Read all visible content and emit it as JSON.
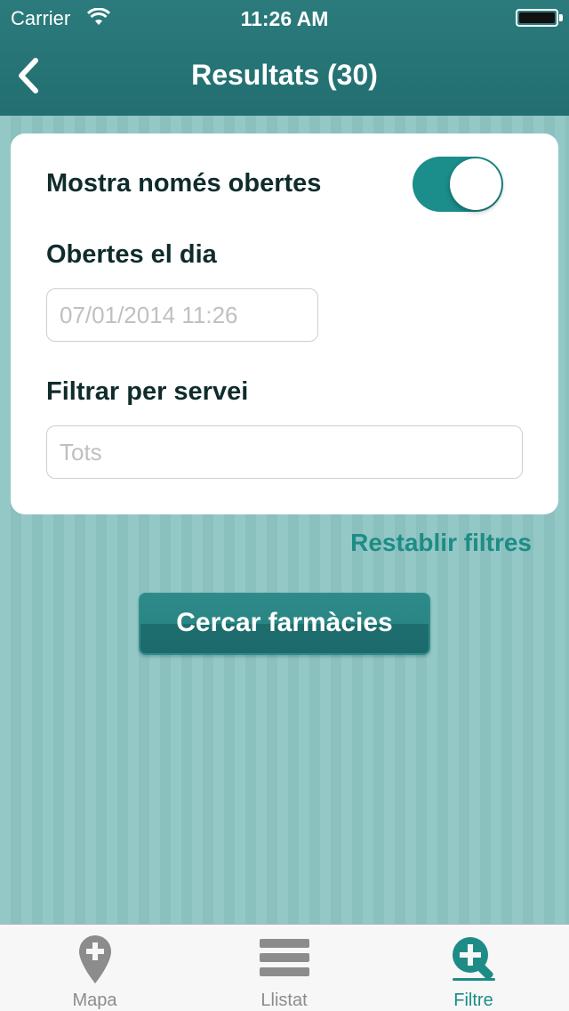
{
  "status_bar": {
    "carrier": "Carrier",
    "time": "11:26 AM"
  },
  "nav": {
    "title": "Resultats (30)",
    "back_icon": "chevron-left-icon"
  },
  "filters": {
    "open_only_label": "Mostra només obertes",
    "open_only_enabled": true,
    "open_on_day_label": "Obertes el dia",
    "date_placeholder": "07/01/2014 11:26",
    "service_label": "Filtrar per servei",
    "service_placeholder": "Tots"
  },
  "actions": {
    "reset_label": "Restablir filtres",
    "search_label": "Cercar farmàcies"
  },
  "tabs": [
    {
      "label": "Mapa",
      "icon": "map-pin-icon",
      "active": false
    },
    {
      "label": "Llistat",
      "icon": "list-icon",
      "active": false
    },
    {
      "label": "Filtre",
      "icon": "filter-search-icon",
      "active": true
    }
  ],
  "colors": {
    "accent": "#1b8d8a",
    "header": "#2a7677",
    "tab_inactive": "#8c8c8c",
    "tab_active": "#1e8c86"
  }
}
